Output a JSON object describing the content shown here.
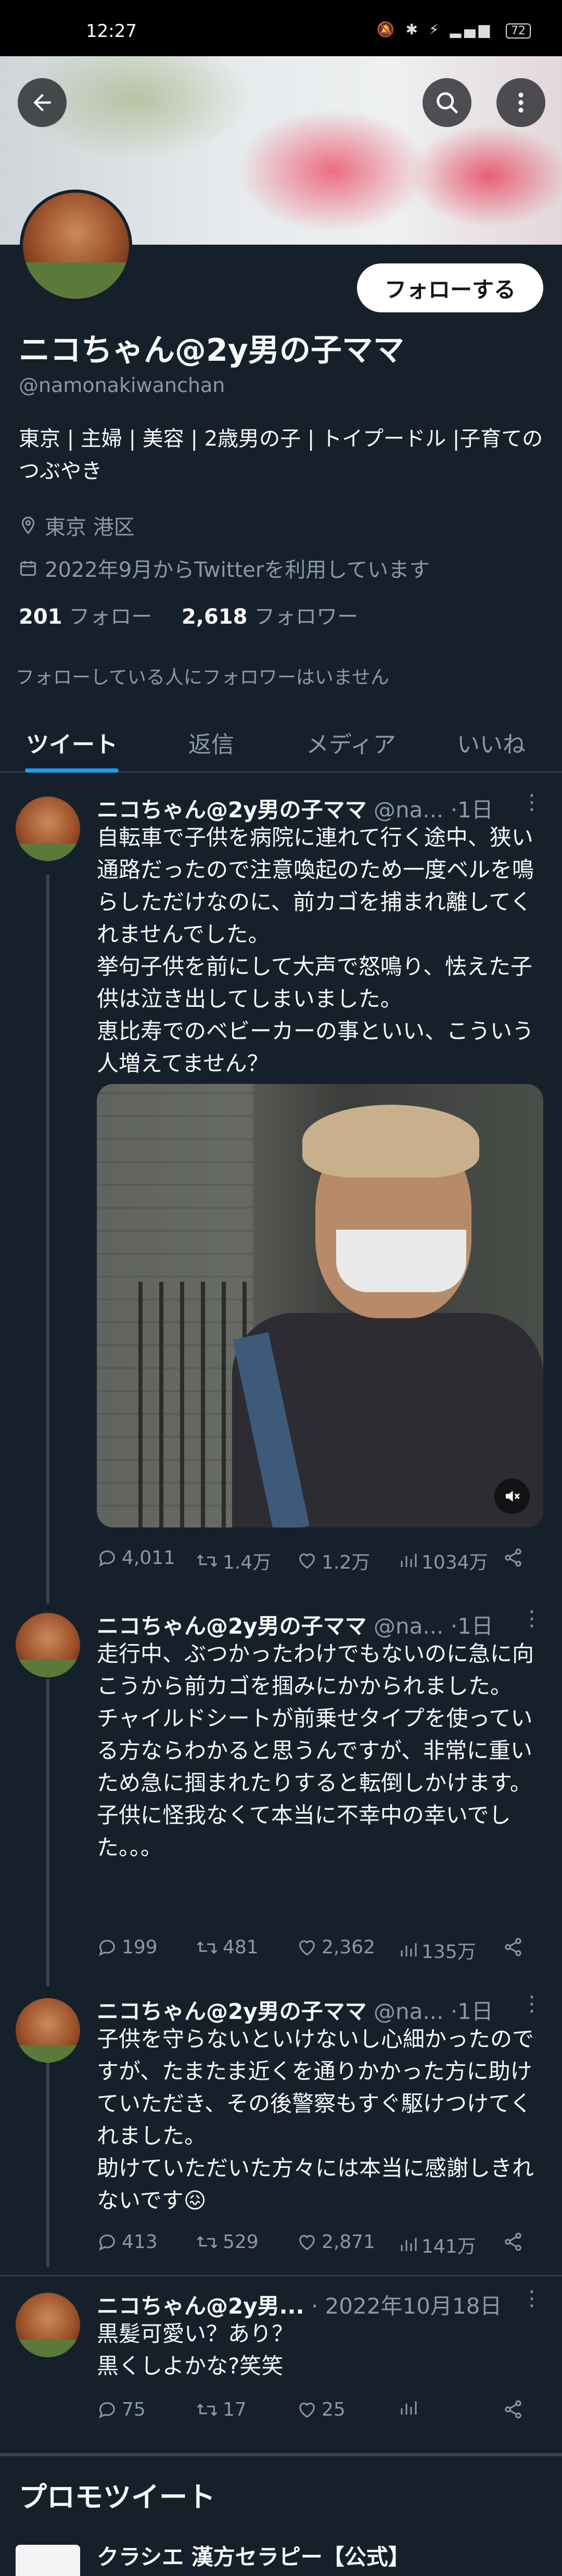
{
  "status_bar": {
    "time": "12:27",
    "icons": "🔕 ✱ ⚡ ▂▄▆",
    "battery": "72"
  },
  "profile": {
    "name": "ニコちゃん@2y男の子ママ",
    "handle": "@namonakiwanchan",
    "bio": "東京 | 主婦 | 美容 | 2歳男の子 | トイプードル |子育てのつぶやき",
    "location": "東京 港区",
    "joined": "2022年9月からTwitterを利用しています",
    "following_count": "201",
    "following_label": "フォロー",
    "followers_count": "2,618",
    "followers_label": "フォロワー",
    "follow_button": "フォローする",
    "no_mutual": "フォローしている人にフォロワーはいません"
  },
  "tabs": [
    "ツイート",
    "返信",
    "メディア",
    "いいね"
  ],
  "tweets": [
    {
      "name": "ニコちゃん@2y男の子ママ",
      "handle": "@na...",
      "time": "·1日",
      "text": "自転車で子供を病院に連れて行く途中、狭い通路だったので注意喚起のため一度ベルを鳴らしただけなのに、前カゴを捕まれ離してくれませんでした。\n挙句子供を前にして大声で怒鳴り、怯えた子供は泣き出してしまいました。\n恵比寿でのベビーカーの事といい、こういう人増えてません？",
      "replies": "4,011",
      "retweets": "1.4万",
      "likes": "1.2万",
      "views": "1034万"
    },
    {
      "name": "ニコちゃん@2y男の子ママ",
      "handle": "@na...",
      "time": "·1日",
      "text": "走行中、ぶつかったわけでもないのに急に向こうから前カゴを掴みにかかられました。\nチャイルドシートが前乗せタイプを使っている方ならわかると思うんですが、非常に重いため急に掴まれたりすると転倒しかけます。\n子供に怪我なくて本当に不幸中の幸いでした。。。",
      "replies": "199",
      "retweets": "481",
      "likes": "2,362",
      "views": "135万"
    },
    {
      "name": "ニコちゃん@2y男の子ママ",
      "handle": "@na...",
      "time": "·1日",
      "text": "子供を守らないといけないし心細かったのですが、たまたま近くを通りかかった方に助けていただき、その後警察もすぐ駆けつけてくれました。\n助けていただいた方々には本当に感謝しきれないです😖",
      "replies": "413",
      "retweets": "529",
      "likes": "2,871",
      "views": "141万"
    },
    {
      "name": "ニコちゃん@2y男...",
      "handle": "",
      "time": "· 2022年10月18日",
      "text": "黒髪可愛い？あり？\n黒くしよかな?笑笑",
      "replies": "75",
      "retweets": "17",
      "likes": "25",
      "views": ""
    }
  ],
  "promo": {
    "title": "プロモツイート",
    "advertiser": "クラシエ 漢方セラピー【公式】"
  }
}
